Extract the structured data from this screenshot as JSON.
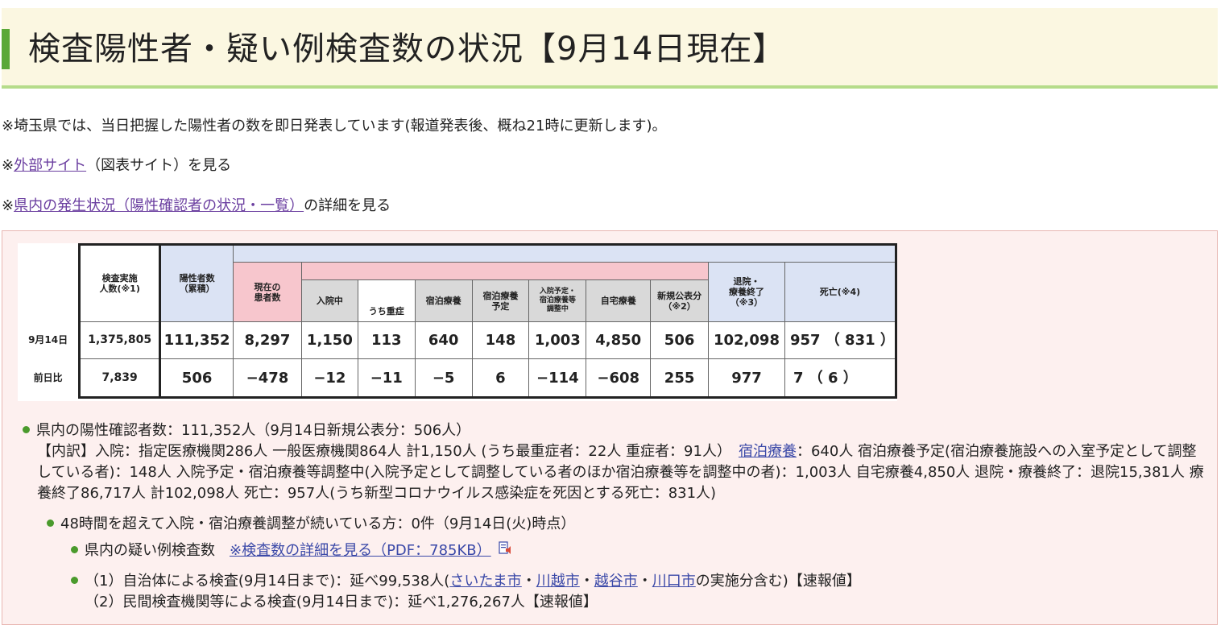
{
  "title": "検査陽性者・疑い例検査数の状況【9月14日現在】",
  "notes": {
    "note1": "※埼玉県では、当日把握した陽性者の数を即日発表しています(報道発表後、概ね21時に更新します)。",
    "note2_prefix": "※",
    "note2_link": "外部サイト",
    "note2_suffix": "（図表サイト）を見る",
    "note3_prefix": "※",
    "note3_link": "県内の発生状況（陽性確認者の状況・一覧）",
    "note3_suffix": "の詳細を見る"
  },
  "table": {
    "headers": {
      "tested": "検査実施\n人数(※1)",
      "positive": "陽性者数\n（累積）",
      "current": "現在の\n患者数",
      "hospitalized": "入院中",
      "severe": "うち重症",
      "hotel": "宿泊療養",
      "hotel_plan": "宿泊療養\n予定",
      "adjusting": "入院予定・\n宿泊療養等\n調整中",
      "home": "自宅療養",
      "new": "新規公表分\n（※2）",
      "discharged": "退院・\n療養終了\n（※3）",
      "death": "死亡(※4)"
    },
    "rows": [
      {
        "label": "9月14日",
        "tested": "1,375,805",
        "positive": "111,352",
        "current": "8,297",
        "hospitalized": "1,150",
        "severe": "113",
        "hotel": "640",
        "hotel_plan": "148",
        "adjusting": "1,003",
        "home": "4,850",
        "new": "506",
        "discharged": "102,098",
        "death": "957 （ 831 ）"
      },
      {
        "label": "前日比",
        "tested": "7,839",
        "positive": "506",
        "current": "−478",
        "hospitalized": "−12",
        "severe": "−11",
        "hotel": "−5",
        "hotel_plan": "6",
        "adjusting": "−114",
        "home": "−608",
        "new": "255",
        "discharged": "977",
        "death": "7 （ 6 ）"
      }
    ]
  },
  "summary": {
    "line1": "県内の陽性確認者数：111,352人（9月14日新規公表分：506人）",
    "breakdown_a": "【内訳】入院：指定医療機関286人 一般医療機関864人 計1,150人 (うち最重症者：22人 重症者：91人）",
    "breakdown_link": "宿泊療養",
    "breakdown_b": "：640人 宿泊療養予定(宿泊療養施設への入室予定として調整している者)：148人 入院予定・宿泊療養等調整中(入院予定として調整している者のほか宿泊療養等を調整中の者)：1,003人 自宅療養4,850人 退院・療養終了：退院15,381人 療養終了86,717人 計102,098人 死亡：957人(うち新型コロナウイルス感染症を死因とする死亡：831人)",
    "line48": "48時間を超えて入院・宿泊療養調整が続いている方：0件（9月14日(火)時点）",
    "suspect_label": "県内の疑い例検査数",
    "suspect_link": "※検査数の詳細を見る（PDF：785KB）",
    "test1_a": "（1）自治体による検査(9月14日まで)：延べ99,538人(",
    "city1": "さいたま市",
    "sep": "・",
    "city2": "川越市",
    "city3": "越谷市",
    "city4": "川口市",
    "test1_b": "の実施分含む)【速報値】",
    "test2": "（2）民間検査機関等による検査(9月14日まで)：延べ1,276,267人【速報値】"
  },
  "colors": {
    "accent_green": "#5aa838",
    "title_bg": "#fbf7e1",
    "panel_bg": "#fdf0ef",
    "link": "#3b49a8"
  }
}
